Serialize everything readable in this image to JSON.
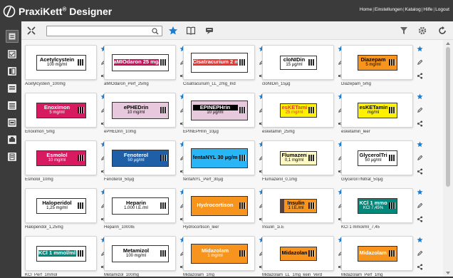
{
  "app": {
    "title": "PraxiKett",
    "title_sup": "®",
    "title_rest": " Designer"
  },
  "top_nav": [
    "Home",
    "Einstellungen",
    "Katalog",
    "Hilfe",
    "Logout"
  ],
  "search": {
    "value": "",
    "placeholder": ""
  },
  "colors": {
    "accent": "#1a7fd4",
    "header": "#3b3b3b"
  },
  "labels": [
    {
      "caption": "Acetylcystein_100mg",
      "line1": "Acetylcystein",
      "line2": "100 mg/ml",
      "bg": "#ffffff",
      "fg": "#000"
    },
    {
      "caption": "aMIOdaron_Perf_25mg",
      "line1": "aMIOdaron 25 mg/ml",
      "line2": "",
      "bg": "#ffffff",
      "fg": "#000",
      "band": "#c2185b"
    },
    {
      "caption": "Cisatracurium_LL_2mg_Ind",
      "line1": "Cisatracurium 2 mg/ml",
      "line2": "",
      "bg": "#ffffff",
      "fg": "#000",
      "band": "#e53935"
    },
    {
      "caption": "cloNIDin_15µg",
      "line1": "cloNIDin",
      "line2": "15 µg/ml",
      "bg": "#ffffff",
      "fg": "#000"
    },
    {
      "caption": "Diazepam_5mg",
      "line1": "Diazepam",
      "line2": "5 mg/ml",
      "bg": "#f7941d",
      "fg": "#000"
    },
    {
      "caption": "Enoximon_5mg",
      "line1": "Enoximon",
      "line2": "5 mg/ml",
      "bg": "#d81b60",
      "fg": "#fff"
    },
    {
      "caption": "ePHEDrin_10mg",
      "line1": "ePHEDrin",
      "line2": "10 mg/ml",
      "bg": "#e8c8dc",
      "fg": "#000"
    },
    {
      "caption": "EPINEPHrin_10µg",
      "line1": "EPINEPHrin",
      "line2": "10 µg/ml",
      "bg": "#e8c8dc",
      "fg": "#000",
      "head": "#000"
    },
    {
      "caption": "esketamin_25mg",
      "line1": "esKETamin",
      "line2": "25 mg/ml",
      "bg": "#fff200",
      "fg": "#d84315"
    },
    {
      "caption": "esketamin_leer",
      "line1": "esKETamin",
      "line2": "mg/ml",
      "bg": "#fff200",
      "fg": "#000"
    },
    {
      "caption": "Esmolol_10mg",
      "line1": "Esmolol",
      "line2": "10 mg/ml",
      "bg": "#d81b60",
      "fg": "#fff"
    },
    {
      "caption": "Fenoterol_50µg",
      "line1": "Fenoterol",
      "line2": "50 µg/ml",
      "bg": "#1e5fa8",
      "fg": "#fff"
    },
    {
      "caption": "fentaNYL_Perf_30µg",
      "line1": "fentaNYL 30 µg/ml",
      "line2": "",
      "bg": "#29b6f6",
      "fg": "#000"
    },
    {
      "caption": "Flumazenil_0,1mg",
      "line1": "Flumazenil",
      "line2": "0,1 mg/ml",
      "bg": "#fff9c4",
      "fg": "#000"
    },
    {
      "caption": "GlycerolTrNitrat_50µg",
      "line1": "GlycerolTriNitrat",
      "line2": "50 µg/ml",
      "bg": "#ffffff",
      "fg": "#000"
    },
    {
      "caption": "Haloperidol_1,25mg",
      "line1": "Haloperidol",
      "line2": "1,25 mg/ml",
      "bg": "#ffffff",
      "fg": "#000"
    },
    {
      "caption": "Heparin_1000IE",
      "line1": "Heparin",
      "line2": "1.000 I.E./ml",
      "bg": "#ffffff",
      "fg": "#000"
    },
    {
      "caption": "Hydrocortison_leer",
      "line1": "Hydrocortison",
      "line2": "",
      "bg": "#f7941d",
      "fg": "#fff"
    },
    {
      "caption": "Insulin_1i.E",
      "line1": "Insulin",
      "line2": "1 I.E./ml",
      "bg": "#f7941d",
      "fg": "#000",
      "side": "#5d4037"
    },
    {
      "caption": "KCl 1 mmol/ml_7,45",
      "line1": "KCl 1 mmol/ml",
      "line2": "KCl 7,45%",
      "bg": "#00897b",
      "fg": "#fff"
    },
    {
      "caption": "KCl_Perf_1mmol",
      "line1": "KCl 1 mmol/ml",
      "line2": "",
      "bg": "#ffffff",
      "fg": "#000",
      "head": "#00897b"
    },
    {
      "caption": "Metamizol_100mg",
      "line1": "Metamizol",
      "line2": "100 mg/ml",
      "bg": "#ffffff",
      "fg": "#000"
    },
    {
      "caption": "Midazolam_1mg",
      "line1": "Midazolam",
      "line2": "1 mg/ml",
      "bg": "#f7941d",
      "fg": "#fff"
    },
    {
      "caption": "Midazolam_LL_1mg_kein_Verd",
      "line1": "Midazolam 1 mg/ml",
      "line2": "",
      "bg": "#f7941d",
      "fg": "#000"
    },
    {
      "caption": "Midazolam_Perf_1mg",
      "line1": "Midazolam 1 mg/ml",
      "line2": "",
      "bg": "#f7941d",
      "fg": "#fff"
    }
  ]
}
